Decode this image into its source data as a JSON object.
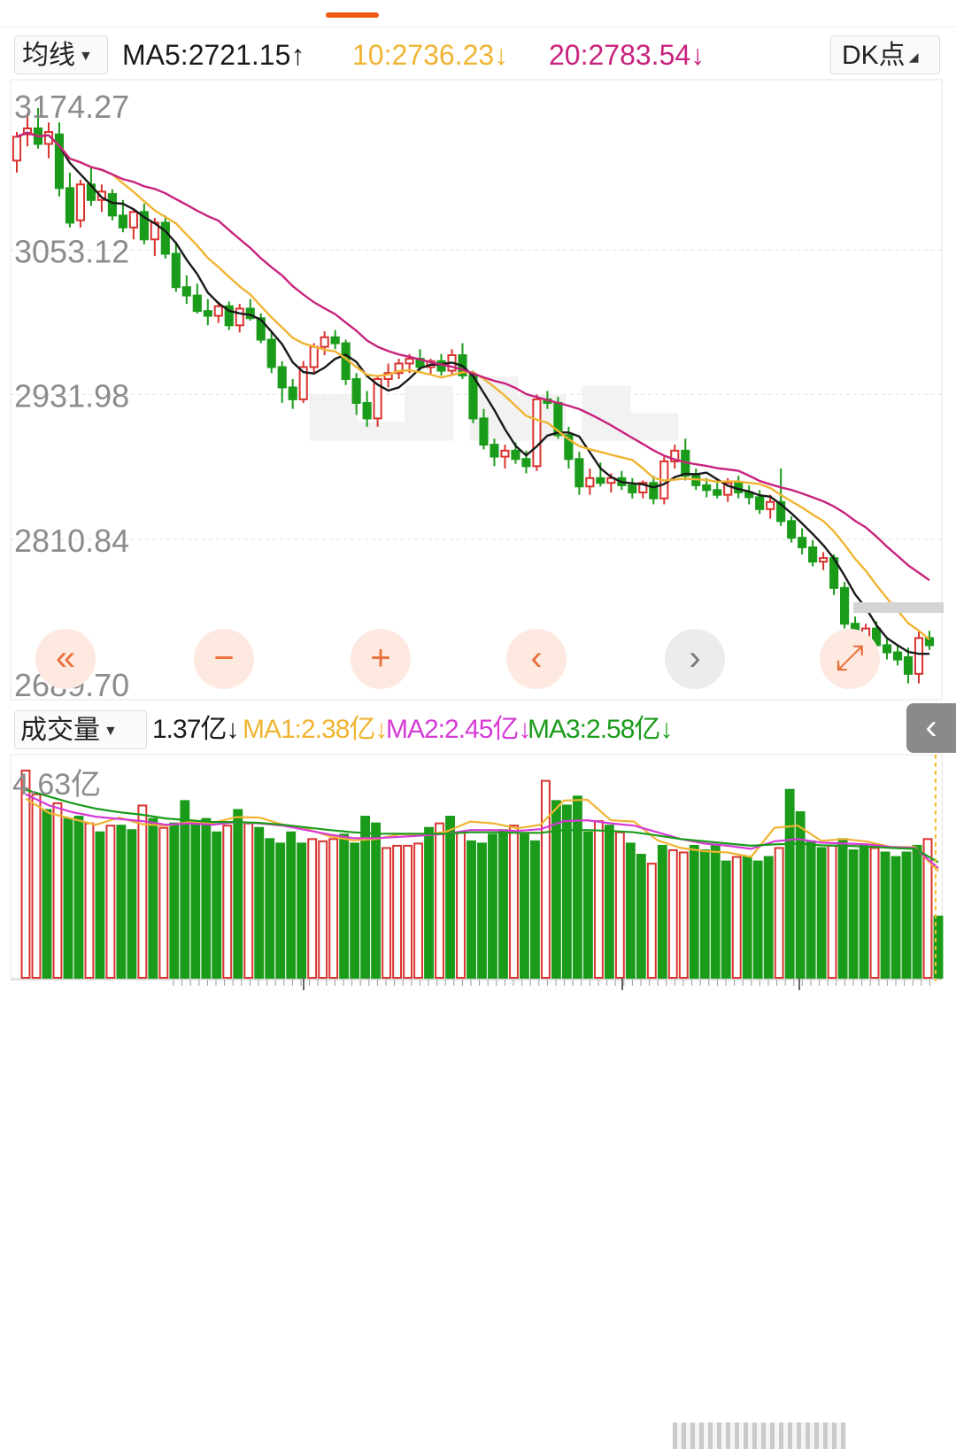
{
  "colors": {
    "up": "#d9332f",
    "down": "#1a9c1a",
    "ma5": "#1a1a1a",
    "ma10": "#f0b432",
    "ma20": "#c8237e",
    "vol_ma1": "#f0b432",
    "vol_ma2": "#d63ad6",
    "vol_ma3": "#1a9c1a",
    "accent": "#f05a14"
  },
  "header": {
    "indicator_select": "均线",
    "ma5_label": "MA5:2721.15",
    "ma5_arrow": "↑",
    "ma10_label": "10:2736.23",
    "ma10_arrow": "↓",
    "ma20_label": "20:2783.54",
    "ma20_arrow": "↓",
    "dk_button": "DK点"
  },
  "volume_header": {
    "indicator_select": "成交量",
    "current": "1.37亿",
    "current_arrow": "↓",
    "ma1_label": "MA1:2.38亿",
    "ma1_arrow": "↓",
    "ma2_label": "MA2:2.45亿",
    "ma2_arrow": "↓",
    "ma3_label": "MA3:2.58亿",
    "ma3_arrow": "↓"
  },
  "controls": {
    "first": "«",
    "zoom_out": "−",
    "zoom_in": "+",
    "prev": "‹",
    "next": "›",
    "fullscreen": "⤢",
    "side_toggle": "‹"
  },
  "chart_data": [
    {
      "type": "candlestick",
      "y_ticks": [
        "3174.27",
        "3053.12",
        "2931.98",
        "2810.84",
        "2689.70"
      ],
      "ylim": [
        2689.7,
        3174.27
      ],
      "grid": true,
      "series": [
        {
          "name": "MA5",
          "last": 2721.15
        },
        {
          "name": "MA10",
          "last": 2736.23
        },
        {
          "name": "MA20",
          "last": 2783.54
        }
      ],
      "ohlc": [
        [
          3128,
          3152,
          3118,
          3148
        ],
        [
          3150,
          3168,
          3140,
          3155
        ],
        [
          3155,
          3172,
          3138,
          3142
        ],
        [
          3142,
          3160,
          3130,
          3152
        ],
        [
          3150,
          3160,
          3098,
          3105
        ],
        [
          3105,
          3118,
          3072,
          3076
        ],
        [
          3078,
          3112,
          3072,
          3108
        ],
        [
          3108,
          3122,
          3090,
          3095
        ],
        [
          3095,
          3108,
          3085,
          3102
        ],
        [
          3100,
          3104,
          3078,
          3082
        ],
        [
          3082,
          3095,
          3068,
          3072
        ],
        [
          3072,
          3088,
          3062,
          3085
        ],
        [
          3085,
          3092,
          3058,
          3062
        ],
        [
          3062,
          3080,
          3048,
          3076
        ],
        [
          3076,
          3082,
          3046,
          3050
        ],
        [
          3050,
          3060,
          3018,
          3022
        ],
        [
          3022,
          3032,
          3008,
          3015
        ],
        [
          3015,
          3025,
          3000,
          3002
        ],
        [
          3002,
          3012,
          2990,
          2998
        ],
        [
          2998,
          3010,
          2992,
          3006
        ],
        [
          3006,
          3010,
          2986,
          2990
        ],
        [
          2990,
          3008,
          2984,
          3004
        ],
        [
          3004,
          3012,
          2994,
          2996
        ],
        [
          2996,
          3000,
          2975,
          2978
        ],
        [
          2978,
          2984,
          2950,
          2955
        ],
        [
          2955,
          2960,
          2925,
          2938
        ],
        [
          2938,
          2945,
          2920,
          2928
        ],
        [
          2928,
          2960,
          2925,
          2955
        ],
        [
          2955,
          2975,
          2950,
          2972
        ],
        [
          2972,
          2985,
          2965,
          2980
        ],
        [
          2980,
          2986,
          2970,
          2975
        ],
        [
          2975,
          2978,
          2940,
          2945
        ],
        [
          2945,
          2950,
          2915,
          2925
        ],
        [
          2925,
          2935,
          2905,
          2912
        ],
        [
          2912,
          2948,
          2905,
          2945
        ],
        [
          2945,
          2958,
          2938,
          2950
        ],
        [
          2950,
          2962,
          2945,
          2958
        ],
        [
          2958,
          2966,
          2950,
          2962
        ],
        [
          2962,
          2970,
          2952,
          2955
        ],
        [
          2955,
          2962,
          2948,
          2960
        ],
        [
          2960,
          2966,
          2948,
          2952
        ],
        [
          2952,
          2970,
          2948,
          2965
        ],
        [
          2965,
          2975,
          2945,
          2948
        ],
        [
          2948,
          2952,
          2908,
          2912
        ],
        [
          2912,
          2920,
          2886,
          2890
        ],
        [
          2890,
          2895,
          2872,
          2880
        ],
        [
          2880,
          2890,
          2870,
          2885
        ],
        [
          2885,
          2892,
          2874,
          2878
        ],
        [
          2878,
          2885,
          2866,
          2872
        ],
        [
          2872,
          2932,
          2868,
          2928
        ],
        [
          2928,
          2935,
          2920,
          2925
        ],
        [
          2925,
          2930,
          2895,
          2898
        ],
        [
          2898,
          2905,
          2870,
          2878
        ],
        [
          2878,
          2884,
          2848,
          2855
        ],
        [
          2855,
          2870,
          2848,
          2862
        ],
        [
          2862,
          2875,
          2855,
          2858
        ],
        [
          2858,
          2866,
          2850,
          2862
        ],
        [
          2862,
          2868,
          2852,
          2856
        ],
        [
          2856,
          2862,
          2845,
          2850
        ],
        [
          2850,
          2860,
          2845,
          2858
        ],
        [
          2858,
          2864,
          2840,
          2845
        ],
        [
          2845,
          2880,
          2840,
          2876
        ],
        [
          2876,
          2890,
          2870,
          2885
        ],
        [
          2885,
          2895,
          2860,
          2864
        ],
        [
          2864,
          2870,
          2852,
          2856
        ],
        [
          2856,
          2862,
          2846,
          2852
        ],
        [
          2852,
          2860,
          2845,
          2848
        ],
        [
          2848,
          2862,
          2842,
          2858
        ],
        [
          2858,
          2864,
          2845,
          2850
        ],
        [
          2850,
          2856,
          2840,
          2846
        ],
        [
          2846,
          2852,
          2832,
          2836
        ],
        [
          2836,
          2848,
          2828,
          2842
        ],
        [
          2842,
          2870,
          2822,
          2826
        ],
        [
          2826,
          2830,
          2808,
          2812
        ],
        [
          2812,
          2820,
          2798,
          2804
        ],
        [
          2804,
          2810,
          2788,
          2792
        ],
        [
          2792,
          2800,
          2785,
          2795
        ],
        [
          2795,
          2798,
          2764,
          2770
        ],
        [
          2770,
          2775,
          2736,
          2740
        ],
        [
          2740,
          2746,
          2720,
          2726
        ],
        [
          2726,
          2740,
          2718,
          2736
        ],
        [
          2736,
          2742,
          2718,
          2722
        ],
        [
          2722,
          2728,
          2710,
          2716
        ],
        [
          2716,
          2722,
          2705,
          2710
        ],
        [
          2712,
          2720,
          2690,
          2698
        ],
        [
          2698,
          2734,
          2690,
          2728
        ],
        [
          2728,
          2734,
          2718,
          2722
        ]
      ]
    },
    {
      "type": "bar",
      "y_ticks": [
        "4.63亿"
      ],
      "ylim": [
        0,
        4.63
      ],
      "unit": "亿",
      "series": [
        {
          "name": "MA1",
          "last": 2.38
        },
        {
          "name": "MA2",
          "last": 2.45
        },
        {
          "name": "MA3",
          "last": 2.58
        }
      ],
      "volumes": [
        4.63,
        4.1,
        3.75,
        3.9,
        3.55,
        3.6,
        3.45,
        3.25,
        3.4,
        3.4,
        3.3,
        3.85,
        3.55,
        3.35,
        3.45,
        3.95,
        3.5,
        3.55,
        3.25,
        3.4,
        3.75,
        3.45,
        3.35,
        3.1,
        3.0,
        3.25,
        3.0,
        3.1,
        3.05,
        3.1,
        3.2,
        3.0,
        3.6,
        3.45,
        2.9,
        2.95,
        2.95,
        3.0,
        3.35,
        3.45,
        3.6,
        3.25,
        3.05,
        3.0,
        3.2,
        3.3,
        3.4,
        3.2,
        3.05,
        4.4,
        3.95,
        3.85,
        4.05,
        3.25,
        3.5,
        3.4,
        3.25,
        3.0,
        2.75,
        2.55,
        2.95,
        2.85,
        2.8,
        2.95,
        2.85,
        2.95,
        2.6,
        2.7,
        2.7,
        2.6,
        2.7,
        2.9,
        4.2,
        3.7,
        3.05,
        2.9,
        2.95,
        3.1,
        2.85,
        2.95,
        2.9,
        2.8,
        2.7,
        2.8,
        2.95,
        3.1,
        1.37
      ],
      "ma_lines": {
        "MA1": [
          4.0,
          3.68,
          3.55,
          3.42,
          3.58,
          3.43,
          3.4,
          3.48,
          3.46,
          3.59,
          3.58,
          3.42,
          3.33,
          3.16,
          3.07,
          3.1,
          3.21,
          3.18,
          3.27,
          3.49,
          3.45,
          3.34,
          3.42,
          3.96,
          3.98,
          3.52,
          3.49,
          3.07,
          2.9,
          2.83,
          2.8,
          2.7,
          3.35,
          3.4,
          3.06,
          3.1,
          3.04,
          2.92,
          2.92,
          2.38
        ],
        "MA2": [
          4.1,
          3.85,
          3.7,
          3.6,
          3.55,
          3.5,
          3.42,
          3.45,
          3.42,
          3.48,
          3.45,
          3.4,
          3.3,
          3.2,
          3.12,
          3.12,
          3.15,
          3.18,
          3.22,
          3.3,
          3.3,
          3.28,
          3.32,
          3.5,
          3.52,
          3.45,
          3.4,
          3.25,
          3.1,
          3.0,
          2.95,
          2.88,
          3.05,
          3.1,
          3.02,
          3.0,
          2.98,
          2.92,
          2.9,
          2.45
        ],
        "MA3": [
          4.2,
          4.05,
          3.9,
          3.78,
          3.7,
          3.64,
          3.56,
          3.52,
          3.48,
          3.48,
          3.46,
          3.42,
          3.36,
          3.3,
          3.25,
          3.22,
          3.22,
          3.22,
          3.22,
          3.25,
          3.25,
          3.24,
          3.24,
          3.3,
          3.3,
          3.28,
          3.25,
          3.18,
          3.1,
          3.05,
          3.0,
          2.95,
          2.98,
          3.0,
          2.96,
          2.95,
          2.93,
          2.9,
          2.88,
          2.58
        ]
      }
    }
  ]
}
